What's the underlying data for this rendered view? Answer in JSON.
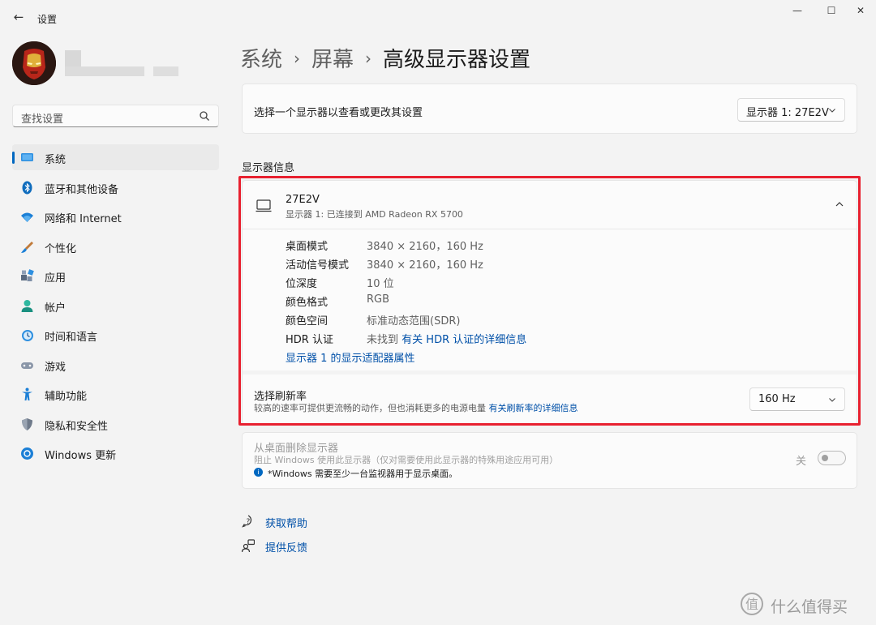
{
  "window": {
    "title": "设置",
    "minimize": "—",
    "maximize": "☐",
    "close": "✕"
  },
  "sidebar": {
    "search_placeholder": "查找设置",
    "items": [
      {
        "label": "系统",
        "icon": "system-icon",
        "active": true
      },
      {
        "label": "蓝牙和其他设备",
        "icon": "bluetooth-icon"
      },
      {
        "label": "网络和 Internet",
        "icon": "wifi-icon"
      },
      {
        "label": "个性化",
        "icon": "brush-icon"
      },
      {
        "label": "应用",
        "icon": "apps-icon"
      },
      {
        "label": "帐户",
        "icon": "account-icon"
      },
      {
        "label": "时间和语言",
        "icon": "clock-icon"
      },
      {
        "label": "游戏",
        "icon": "gamepad-icon"
      },
      {
        "label": "辅助功能",
        "icon": "accessibility-icon"
      },
      {
        "label": "隐私和安全性",
        "icon": "shield-icon"
      },
      {
        "label": "Windows 更新",
        "icon": "update-icon"
      }
    ]
  },
  "breadcrumb": {
    "level1": "系统",
    "level2": "屏幕",
    "current": "高级显示器设置",
    "sep": "›"
  },
  "select_display": {
    "label": "选择一个显示器以查看或更改其设置",
    "value": "显示器 1: 27E2V"
  },
  "display_info": {
    "section_title": "显示器信息",
    "name": "27E2V",
    "subtitle": "显示器 1: 已连接到 AMD Radeon RX 5700",
    "props": [
      {
        "key": "桌面模式",
        "value": "3840 × 2160，160 Hz"
      },
      {
        "key": "活动信号模式",
        "value": "3840 × 2160，160 Hz"
      },
      {
        "key": "位深度",
        "value": "10 位"
      },
      {
        "key": "颜色格式",
        "value": "RGB"
      },
      {
        "key": "颜色空间",
        "value": "标准动态范围(SDR)"
      },
      {
        "key": "HDR 认证",
        "value": "未找到",
        "link": "有关 HDR 认证的详细信息"
      }
    ],
    "adapter_link": "显示器 1 的显示适配器属性"
  },
  "refresh": {
    "title": "选择刷新率",
    "subtitle": "较高的速率可提供更流畅的动作，但也消耗更多的电源电量",
    "link": "有关刷新率的详细信息",
    "value": "160 Hz"
  },
  "remove": {
    "title": "从桌面删除显示器",
    "subtitle": "阻止 Windows 使用此显示器（仅对需要使用此显示器的特殊用途应用可用）",
    "note": "*Windows 需要至少一台监视器用于显示桌面。",
    "toggle_label": "关",
    "toggle_on": false
  },
  "help": {
    "get_help": "获取帮助",
    "feedback": "提供反馈"
  },
  "watermark": {
    "text": "什么值得买"
  },
  "colors": {
    "accent": "#0067c0",
    "link": "#0050a8",
    "highlight": "#e8202f"
  }
}
